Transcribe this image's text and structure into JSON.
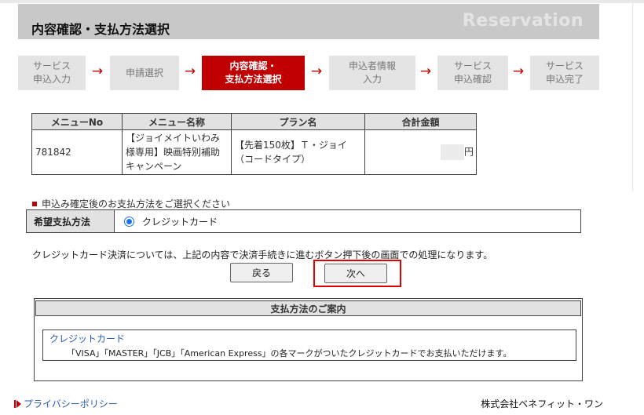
{
  "header": {
    "title": "内容確認・支払方法選択",
    "brand": "Reservation"
  },
  "steps": [
    {
      "label": "サービス\n申込入力",
      "active": false
    },
    {
      "label": "申請選択",
      "active": false
    },
    {
      "label": "内容確認・\n支払方法選択",
      "active": true
    },
    {
      "label": "申込者情報\n入力",
      "active": false
    },
    {
      "label": "サービス\n申込確認",
      "active": false
    },
    {
      "label": "サービス\n申込完了",
      "active": false
    }
  ],
  "step_arrow": "→",
  "order_table": {
    "headers": [
      "メニューNo",
      "メニュー名称",
      "プラン名",
      "合計金額"
    ],
    "row": {
      "menu_no": "781842",
      "menu_name": "【ジョイメイトいわみ様専用】映画特別補助キャンペーン",
      "plan_name": "【先着150枚】Ｔ・ジョイ（コードタイプ）",
      "total_suffix": "円"
    }
  },
  "payment": {
    "note": "申込み確定後のお支払方法をご選択ください",
    "label": "希望支払方法",
    "option": "クレジットカード",
    "selected": true
  },
  "cc_note": "クレジットカード決済については、上記の内容で決済手続きに進むボタン押下後の画面での処理になります。",
  "buttons": {
    "back": "戻る",
    "next": "次へ"
  },
  "guide": {
    "heading": "支払方法のご案内",
    "item_title": "クレジットカード",
    "item_body": "「VISA」「MASTER」「JCB」「American Express」の各マークがついたクレジットカードでお支払いただけます。"
  },
  "footer": {
    "privacy_link": "プライバシーポリシー",
    "company": "株式会社ベネフィット・ワン"
  },
  "colors": {
    "accent": "#c00000",
    "header_bg": "#c8c8c8",
    "step_bg": "#e4e4e4",
    "link": "#2a5bb5",
    "radio": "#1a73e8"
  }
}
